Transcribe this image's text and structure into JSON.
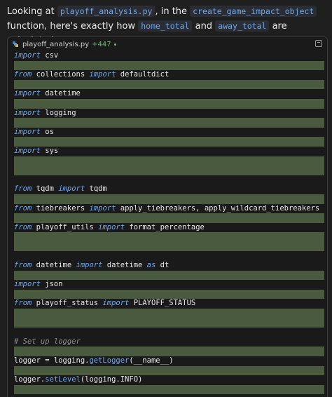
{
  "intro": {
    "t1": "Looking at ",
    "file": "playoff_analysis.py",
    "t2": ", in the ",
    "func": "create_game_impact_object",
    "t3": " function, here's exactly how ",
    "var1": "home_total",
    "t4": " and ",
    "var2": "away_total",
    "t5": " are calculated:"
  },
  "file_header": {
    "filename": "playoff_analysis.py",
    "diff": "+447",
    "icon": "python-file-icon",
    "expand_icon": "expand-icon"
  },
  "colors": {
    "added_line_bg": "#4a5a3e",
    "keyword": "#6ea8ee",
    "diff_green": "#6fbf73"
  },
  "code_lines": [
    {
      "added": false,
      "parts": [
        {
          "t": "import",
          "c": "kw"
        },
        {
          "t": " csv"
        }
      ]
    },
    {
      "added": true,
      "parts": []
    },
    {
      "added": false,
      "parts": [
        {
          "t": "from",
          "c": "kw"
        },
        {
          "t": " collections "
        },
        {
          "t": "import",
          "c": "kw"
        },
        {
          "t": " defaultdict"
        }
      ]
    },
    {
      "added": true,
      "parts": []
    },
    {
      "added": false,
      "parts": [
        {
          "t": "import",
          "c": "kw"
        },
        {
          "t": " datetime"
        }
      ]
    },
    {
      "added": true,
      "parts": []
    },
    {
      "added": false,
      "parts": [
        {
          "t": "import",
          "c": "kw"
        },
        {
          "t": " logging"
        }
      ]
    },
    {
      "added": true,
      "parts": []
    },
    {
      "added": false,
      "parts": [
        {
          "t": "import",
          "c": "kw"
        },
        {
          "t": " os"
        }
      ]
    },
    {
      "added": true,
      "parts": []
    },
    {
      "added": false,
      "parts": [
        {
          "t": "import",
          "c": "kw"
        },
        {
          "t": " sys"
        }
      ]
    },
    {
      "added": true,
      "parts": []
    },
    {
      "added": true,
      "parts": []
    },
    {
      "added": false,
      "parts": []
    },
    {
      "added": false,
      "parts": [
        {
          "t": "from",
          "c": "kw"
        },
        {
          "t": " tqdm "
        },
        {
          "t": "import",
          "c": "kw"
        },
        {
          "t": " tqdm"
        }
      ]
    },
    {
      "added": true,
      "parts": []
    },
    {
      "added": false,
      "parts": [
        {
          "t": "from",
          "c": "kw"
        },
        {
          "t": " tiebreakers "
        },
        {
          "t": "import",
          "c": "kw"
        },
        {
          "t": " apply_tiebreakers, apply_wildcard_tiebreakers"
        }
      ]
    },
    {
      "added": true,
      "parts": []
    },
    {
      "added": false,
      "parts": [
        {
          "t": "from",
          "c": "kw"
        },
        {
          "t": " playoff_utils "
        },
        {
          "t": "import",
          "c": "kw"
        },
        {
          "t": " format_percentage"
        }
      ]
    },
    {
      "added": true,
      "parts": []
    },
    {
      "added": true,
      "parts": []
    },
    {
      "added": false,
      "parts": []
    },
    {
      "added": false,
      "parts": [
        {
          "t": "from",
          "c": "kw"
        },
        {
          "t": " datetime "
        },
        {
          "t": "import",
          "c": "kw"
        },
        {
          "t": " datetime "
        },
        {
          "t": "as",
          "c": "kw"
        },
        {
          "t": " dt"
        }
      ]
    },
    {
      "added": true,
      "parts": []
    },
    {
      "added": false,
      "parts": [
        {
          "t": "import",
          "c": "kw"
        },
        {
          "t": " json"
        }
      ]
    },
    {
      "added": true,
      "parts": []
    },
    {
      "added": false,
      "parts": [
        {
          "t": "from",
          "c": "kw"
        },
        {
          "t": " playoff_status "
        },
        {
          "t": "import",
          "c": "kw"
        },
        {
          "t": " PLAYOFF_STATUS"
        }
      ]
    },
    {
      "added": true,
      "parts": []
    },
    {
      "added": true,
      "parts": []
    },
    {
      "added": false,
      "parts": []
    },
    {
      "added": false,
      "parts": [
        {
          "t": "# Set up logger",
          "c": "cm"
        }
      ]
    },
    {
      "added": true,
      "parts": []
    },
    {
      "added": false,
      "parts": [
        {
          "t": "logger = logging."
        },
        {
          "t": "getLogger",
          "c": "fn"
        },
        {
          "t": "(__name__)"
        }
      ]
    },
    {
      "added": true,
      "parts": []
    },
    {
      "added": false,
      "parts": [
        {
          "t": "logger."
        },
        {
          "t": "setLevel",
          "c": "fn"
        },
        {
          "t": "(logging.INFO)"
        }
      ]
    },
    {
      "added": true,
      "parts": []
    }
  ]
}
